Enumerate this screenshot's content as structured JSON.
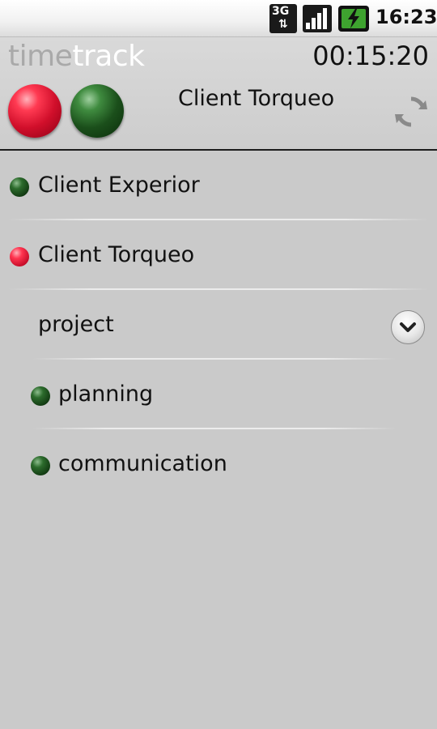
{
  "status_bar": {
    "network_label": "3G",
    "network_arrows": "⇅",
    "time": "16:23"
  },
  "header": {
    "logo_part1": "time",
    "logo_part2": "track",
    "timer": "00:15:20",
    "current_client": "Client Torqueo"
  },
  "list": {
    "items": [
      {
        "label": "Client Experior",
        "status": "green"
      },
      {
        "label": "Client Torqueo",
        "status": "red"
      },
      {
        "label": "project",
        "expandable": true
      },
      {
        "label": "planning",
        "status": "green"
      },
      {
        "label": "communication",
        "status": "green"
      }
    ]
  },
  "colors": {
    "background": "#cacaca",
    "active_red": "#d10f2b",
    "idle_green": "#1b4f1b"
  }
}
